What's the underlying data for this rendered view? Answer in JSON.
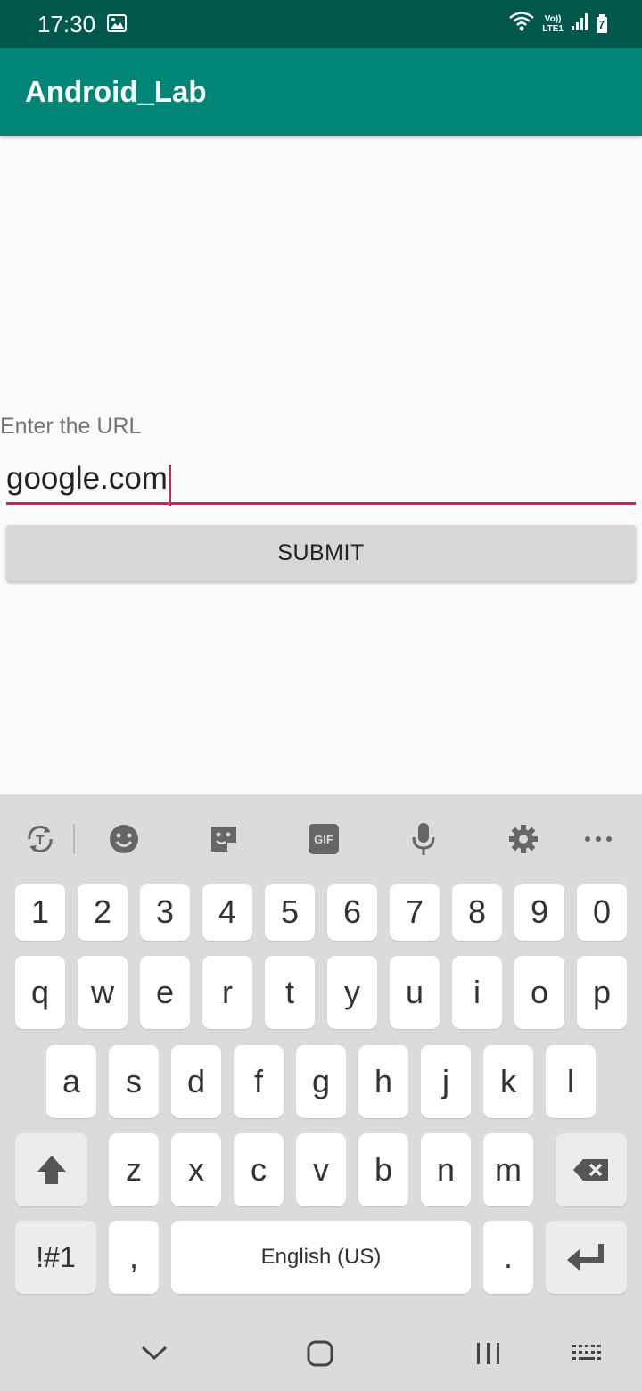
{
  "status_bar": {
    "time": "17:30",
    "gallery_icon": "image-icon",
    "network_top": "Vo))",
    "network_bottom": "LTE1",
    "battery_level": "7"
  },
  "app": {
    "title": "Android_Lab"
  },
  "form": {
    "label": "Enter the URL",
    "url_value": "google.com",
    "submit_label": "SUBMIT"
  },
  "keyboard": {
    "toolbar": [
      "translate-icon",
      "emoji-icon",
      "sticker-icon",
      "gif-icon",
      "mic-icon",
      "settings-icon",
      "more-icon"
    ],
    "gif_text": "GIF",
    "row_numbers": [
      "1",
      "2",
      "3",
      "4",
      "5",
      "6",
      "7",
      "8",
      "9",
      "0"
    ],
    "row_top": [
      "q",
      "w",
      "e",
      "r",
      "t",
      "y",
      "u",
      "i",
      "o",
      "p"
    ],
    "row_middle": [
      "a",
      "s",
      "d",
      "f",
      "g",
      "h",
      "j",
      "k",
      "l"
    ],
    "row_bottom": [
      "z",
      "x",
      "c",
      "v",
      "b",
      "n",
      "m"
    ],
    "symbols_label": "!#1",
    "comma": ",",
    "space_label": "English (US)",
    "period": "."
  },
  "nav": [
    "back-chevron-icon",
    "home-icon",
    "recents-icon",
    "keyboard-icon"
  ],
  "colors": {
    "status_bar": "#00574b",
    "app_bar": "#008577",
    "accent": "#d81b60",
    "button": "#d6d7d7"
  }
}
